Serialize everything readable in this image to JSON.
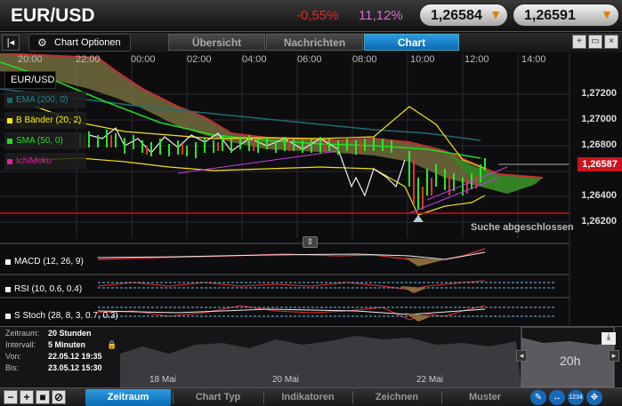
{
  "header": {
    "pair": "EUR/USD",
    "change_pct": "-0,55%",
    "volatility_pct": "11,12%",
    "bid": "1,26584",
    "ask": "1,26591",
    "bid_arrow": "▼",
    "ask_arrow": "▼"
  },
  "tabbar": {
    "collapse_icon": "|◂",
    "chart_options": "Chart Optionen",
    "tabs": [
      {
        "label": "Übersicht"
      },
      {
        "label": "Nachrichten"
      },
      {
        "label": "Chart"
      }
    ],
    "window_buttons": [
      "+",
      "▭",
      "×"
    ]
  },
  "chart": {
    "time_labels": [
      "20:00",
      "22:00",
      "00:00",
      "02:00",
      "04:00",
      "06:00",
      "08:00",
      "10:00",
      "12:00",
      "14:00"
    ],
    "price_labels": [
      "1,27200",
      "1,27000",
      "1,26800",
      "1,26400",
      "1,26200"
    ],
    "current_price": "1,26587",
    "legend_title": "EUR/USD",
    "legend": [
      {
        "label": "EMA (200, 0)",
        "color": "#1a6a6a"
      },
      {
        "label": "B Bänder (20, 2)",
        "color": "#ffee00"
      },
      {
        "label": "SMA (50, 0)",
        "color": "#22dd22"
      },
      {
        "label": "IchiMoku",
        "color": "#e0209a"
      }
    ],
    "status_text": "Suche abgeschlossen",
    "scroll_icon": "⇕"
  },
  "indicators": {
    "macd": "MACD (12, 26, 9)",
    "rsi": "RSI (10, 0.6, 0.4)",
    "stoch": "S Stoch (28, 8, 3, 0.7, 0.3)"
  },
  "navigator": {
    "rows": [
      {
        "key": "Zeitraum:",
        "value": "20 Stunden"
      },
      {
        "key": "Intervall:",
        "value": "5 Minuten"
      },
      {
        "key": "Von:",
        "value": "22.05.12 19:35"
      },
      {
        "key": "Bis:",
        "value": "23.05.12 15:30"
      }
    ],
    "lock_icon": "🔒",
    "dates": [
      "18 Mai",
      "20 Mai",
      "22 Mai"
    ],
    "window_label": "20h",
    "download_icon": "⤓"
  },
  "toolbar": {
    "buttons": [
      "−",
      "+",
      "■",
      "⊘"
    ],
    "tabs": [
      {
        "label": "Zeitraum"
      },
      {
        "label": "Chart Typ"
      },
      {
        "label": "Indikatoren"
      },
      {
        "label": "Zeichnen"
      },
      {
        "label": "Muster"
      }
    ],
    "tools": [
      "✎",
      "↔",
      "1234",
      "✥"
    ]
  }
}
